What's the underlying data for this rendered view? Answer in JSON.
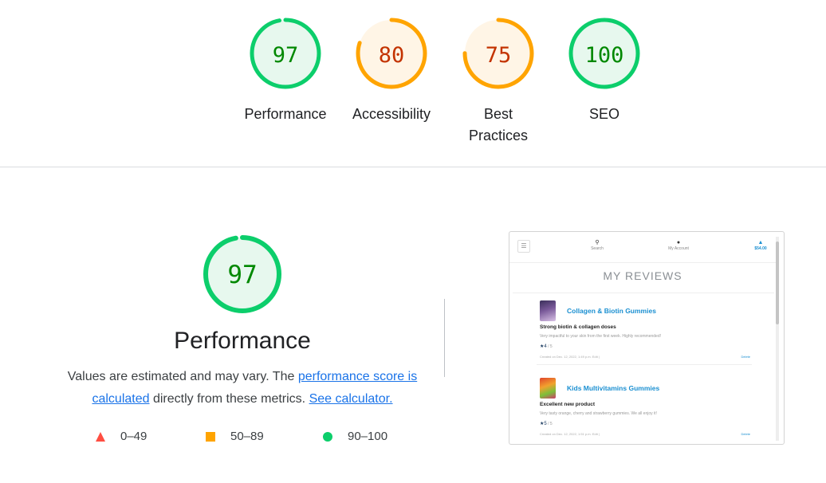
{
  "gauges": [
    {
      "score": "97",
      "value": 97,
      "label": "Performance",
      "level": "pass"
    },
    {
      "score": "80",
      "value": 80,
      "label": "Accessibility",
      "level": "average"
    },
    {
      "score": "75",
      "value": 75,
      "label": "Best Practices",
      "level": "average"
    },
    {
      "score": "100",
      "value": 100,
      "label": "SEO",
      "level": "pass"
    }
  ],
  "colors": {
    "pass": "#0cce6b",
    "pass_text": "#008800",
    "pass_bg": "#e7f8ee",
    "average": "#ffa400",
    "average_text": "#c33300",
    "average_bg": "#fff5e6",
    "fail": "#ff4e42",
    "link": "#1a73e8"
  },
  "main": {
    "score": "97",
    "value": 97,
    "title": "Performance",
    "desc_part1": "Values are estimated and may vary. The ",
    "desc_link1": "performance score is calculated",
    "desc_part2": " directly from these metrics. ",
    "desc_link2": "See calculator."
  },
  "legend": [
    {
      "shape": "triangle-icon",
      "range": "0–49",
      "color": "#ff4e42"
    },
    {
      "shape": "square-icon",
      "range": "50–89",
      "color": "#ffa400"
    },
    {
      "shape": "circle-icon",
      "range": "90–100",
      "color": "#0cce6b"
    }
  ],
  "screenshot": {
    "nav": {
      "search": "Search",
      "account": "My Account",
      "cart": "$54.00"
    },
    "heading": "MY REVIEWS",
    "reviews": [
      {
        "product": "Collagen & Biotin Gummies",
        "title": "Strong biotin & collagen doses",
        "text": "Very impactful to your skin from the first week. Highly recommended!",
        "rating": "4",
        "rating_of": " / 5",
        "created": "Created on Dec. 12, 2022, 1:49 p.m. Edit |",
        "delete": "Delete"
      },
      {
        "product": "Kids Multivitamins Gummies",
        "title": "Excellent new product",
        "text": "Very tasty orange, cherry and strawberry gummies. We all enjoy it!",
        "rating": "5",
        "rating_of": " / 5",
        "created": "Created on Dec. 12, 2022, 1:51 p.m. Edit |",
        "delete": "Delete"
      }
    ]
  }
}
